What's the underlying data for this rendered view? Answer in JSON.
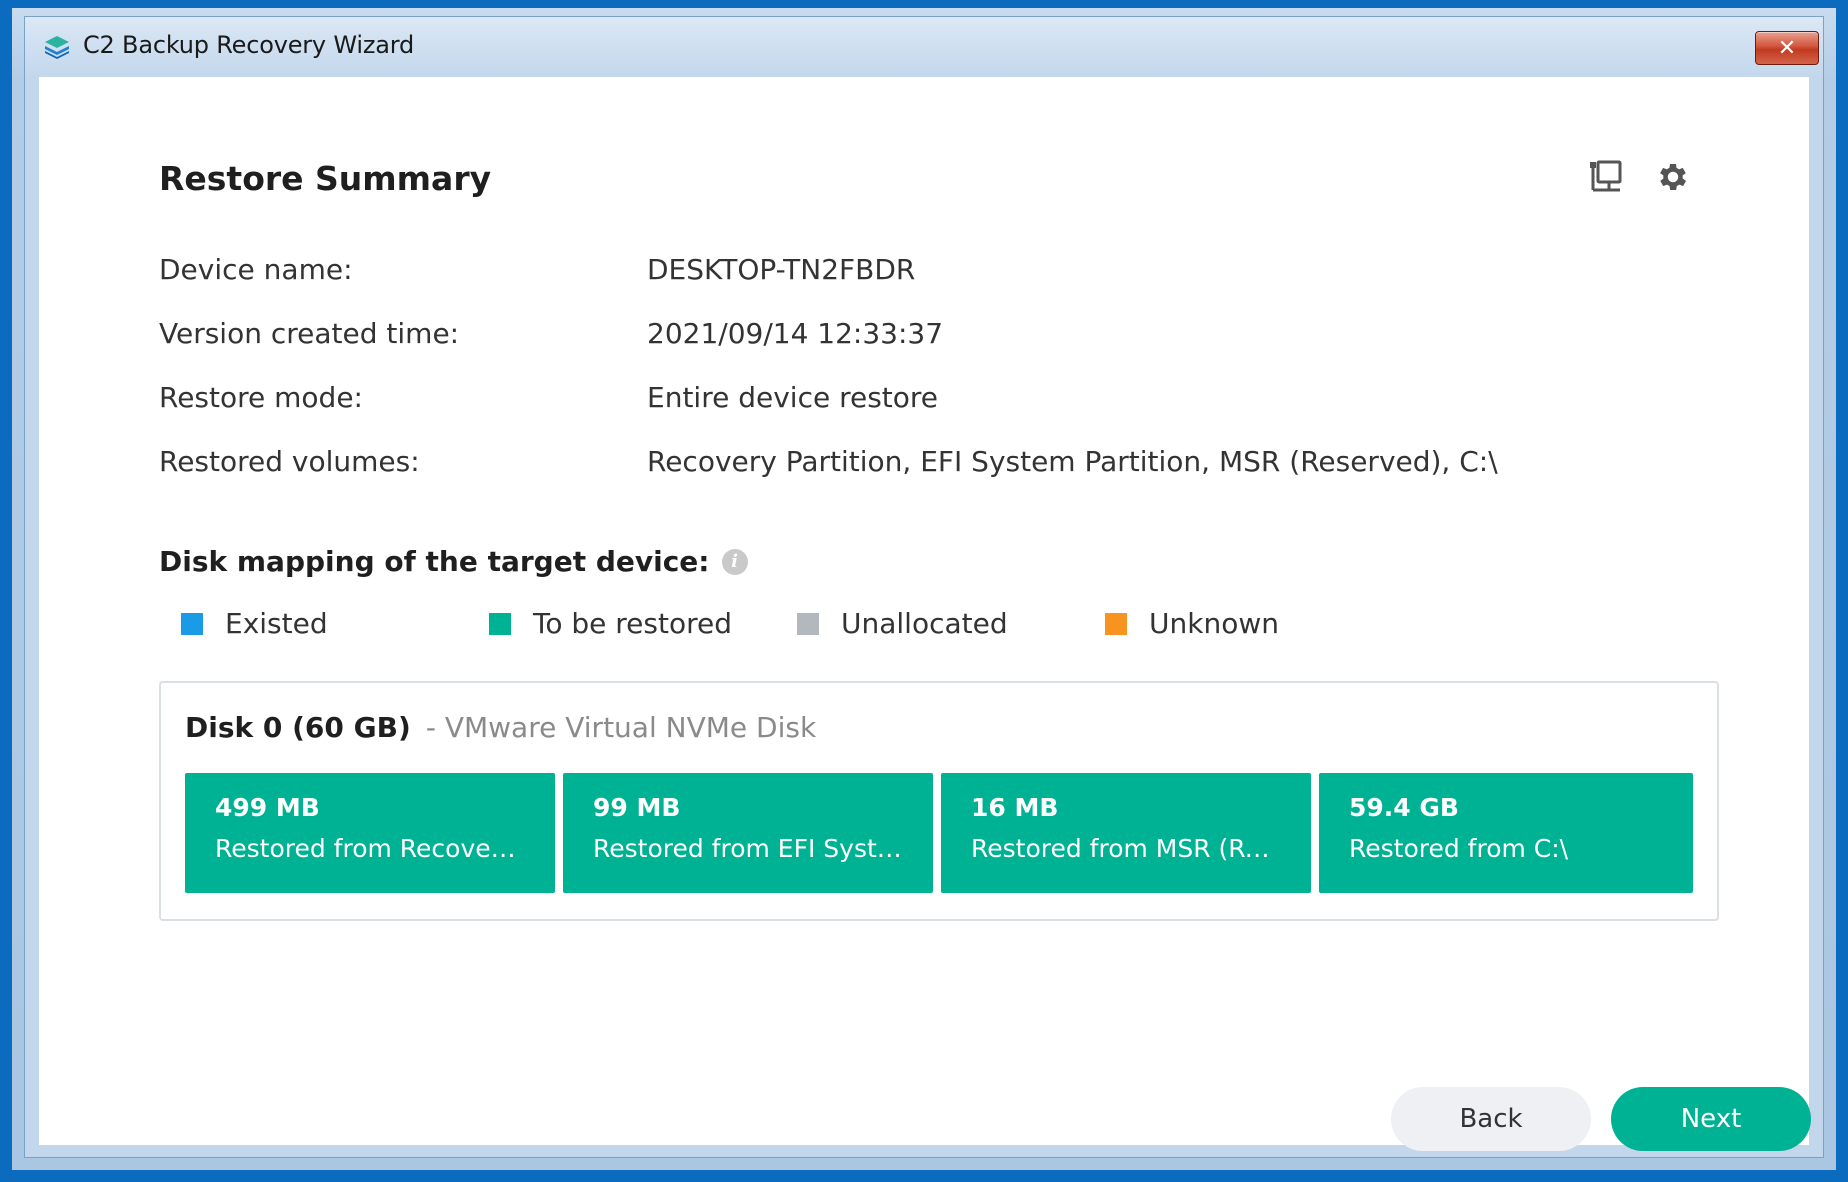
{
  "window": {
    "title": "C2 Backup Recovery Wizard",
    "close_glyph": "✕"
  },
  "header": {
    "title": "Restore Summary",
    "icons": [
      "network-icon",
      "gear-icon"
    ]
  },
  "info": {
    "rows": [
      {
        "label": "Device name:",
        "value": "DESKTOP-TN2FBDR"
      },
      {
        "label": "Version created time:",
        "value": "2021/09/14 12:33:37"
      },
      {
        "label": "Restore mode:",
        "value": "Entire device restore"
      },
      {
        "label": "Restored volumes:",
        "value": "Recovery Partition, EFI System Partition, MSR (Reserved), C:\\"
      }
    ]
  },
  "disk_mapping": {
    "title": "Disk mapping of the target device:",
    "info_glyph": "i",
    "legend": [
      {
        "label": "Existed",
        "color": "#1a9be6"
      },
      {
        "label": "To be restored",
        "color": "#00b294"
      },
      {
        "label": "Unallocated",
        "color": "#b3b8bf"
      },
      {
        "label": "Unknown",
        "color": "#f7931e"
      }
    ],
    "disk": {
      "name": "Disk 0 (60 GB)",
      "model": "- VMware Virtual NVMe Disk",
      "partitions": [
        {
          "size": "499 MB",
          "desc": "Restored from Recovery..."
        },
        {
          "size": "99 MB",
          "desc": "Restored from EFI Syste..."
        },
        {
          "size": "16 MB",
          "desc": "Restored from MSR (Res..."
        },
        {
          "size": "59.4 GB",
          "desc": "Restored from C:\\"
        }
      ]
    }
  },
  "footer": {
    "back_label": "Back",
    "next_label": "Next"
  },
  "colors": {
    "accent": "#00b294",
    "window_border": "#0a6bbf"
  }
}
